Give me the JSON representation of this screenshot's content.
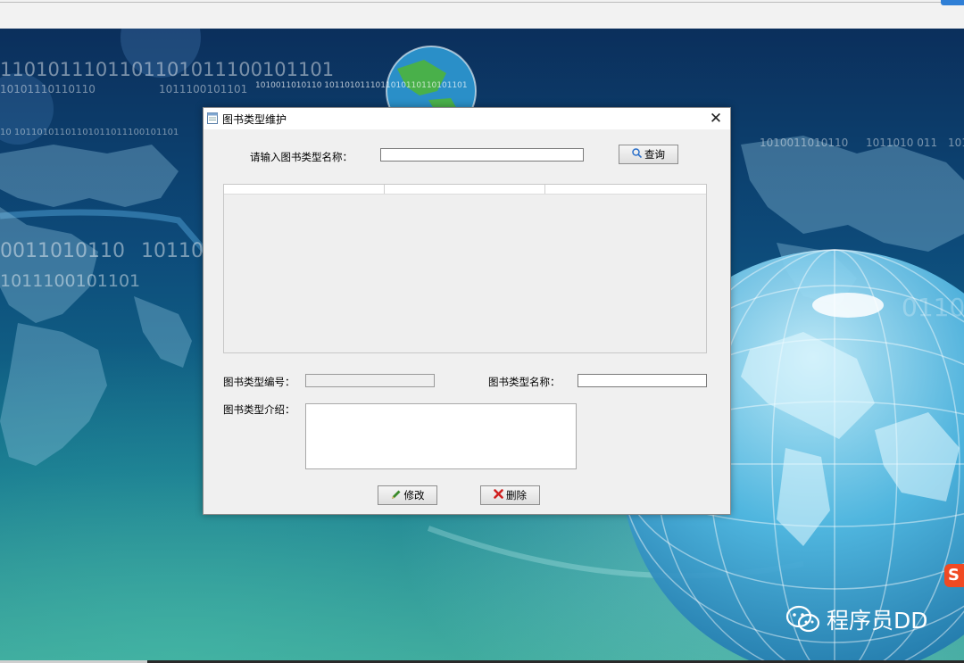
{
  "background": {
    "binary_strings": [
      "1101011101101101011100101101",
      "10101110110110",
      "1011100101101",
      "1010011010110 1011010111011010110110101101",
      "10 10110101101101011011100101101",
      "0011010110",
      "101101",
      "1011100101101",
      "1010011010110",
      "1011010 011",
      "101",
      "0110"
    ],
    "watermark": "程序员DD",
    "sohu_mark": "S"
  },
  "dialog": {
    "title": "图书类型维护",
    "close_glyph": "✕",
    "search_label": "请输入图书类型名称：",
    "search_value": "",
    "query_button": "查询",
    "table_columns": [
      "",
      "",
      ""
    ],
    "id_label": "图书类型编号：",
    "id_value": "",
    "name_label": "图书类型名称：",
    "name_value": "",
    "desc_label": "图书类型介绍：",
    "desc_value": "",
    "modify_button": "修改",
    "delete_button": "删除",
    "icons": {
      "query": "search-icon",
      "modify": "pencil-icon",
      "delete": "x-icon"
    },
    "colors": {
      "pencil": "#3a8a2a",
      "delete": "#d02020"
    }
  }
}
